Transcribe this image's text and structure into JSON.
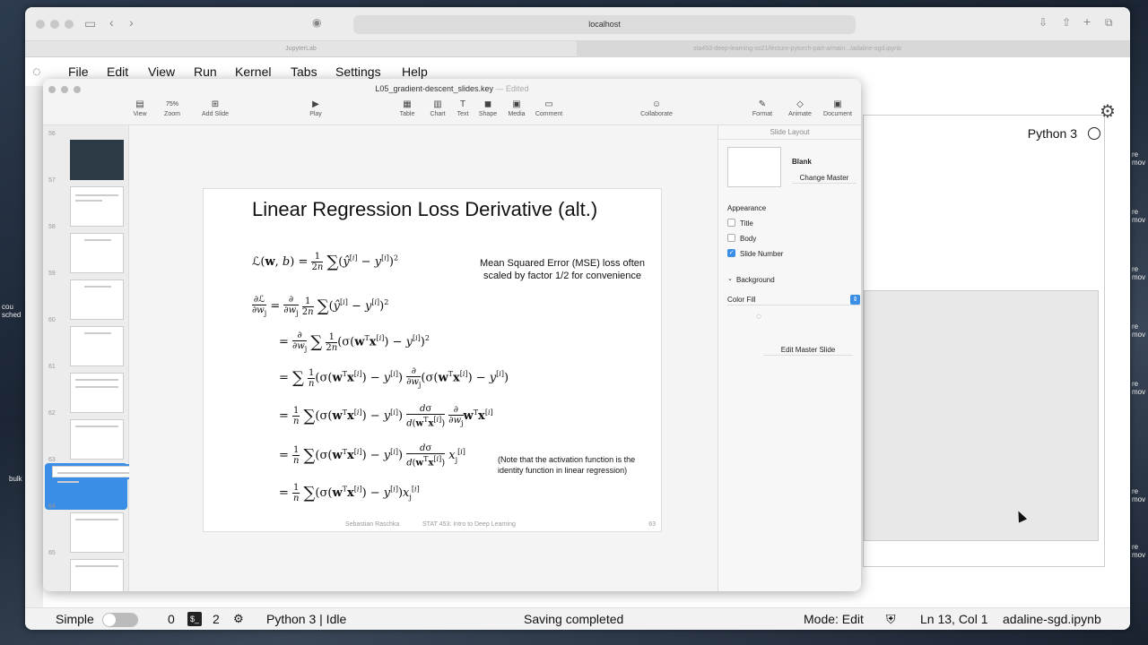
{
  "browser": {
    "url": "localhost",
    "tab1": "JupyterLab",
    "tab2": "sta453-deep-learning-ss21/lecture-pytorch-part-a/main.../adaline-sgd.ipynb"
  },
  "jupyter": {
    "menu": [
      "File",
      "Edit",
      "View",
      "Run",
      "Kernel",
      "Tabs",
      "Settings",
      "Help"
    ],
    "kernel": "Python 3",
    "status": {
      "mode_label": "Simple",
      "count_a": "0",
      "count_b": "2",
      "kernel_state": "Python 3 | Idle",
      "save_state": "Saving completed",
      "mode": "Mode: Edit",
      "cursor": "Ln 13, Col 1",
      "filename": "adaline-sgd.ipynb"
    }
  },
  "keynote": {
    "doc_title": "L05_gradient-descent_slides.key",
    "edited": "— Edited",
    "toolbar": {
      "view": "View",
      "zoom_value": "75%",
      "zoom": "Zoom",
      "add_slide": "Add Slide",
      "play": "Play",
      "table": "Table",
      "chart": "Chart",
      "text": "Text",
      "shape": "Shape",
      "media": "Media",
      "comment": "Comment",
      "collaborate": "Collaborate",
      "format": "Format",
      "animate": "Animate",
      "document": "Document"
    },
    "thumb_numbers": [
      "56",
      "57",
      "58",
      "59",
      "60",
      "61",
      "62",
      "63",
      "64",
      "65"
    ],
    "slide": {
      "title": "Linear Regression Loss Derivative (alt.)",
      "note1_line1": "Mean Squared Error (MSE) loss often",
      "note1_line2": "scaled by factor 1/2 for convenience",
      "note2_line1": "(Note that the activation function is the",
      "note2_line2": "identity function in linear regression)",
      "footer_author": "Sebastian Raschka",
      "footer_course": "STAT 453: Intro to Deep Learning",
      "page": "63"
    },
    "inspector": {
      "header": "Slide Layout",
      "blank": "Blank",
      "change_master": "Change Master",
      "appearance": "Appearance",
      "title": "Title",
      "body": "Body",
      "slide_number": "Slide Number",
      "background": "Background",
      "color_fill": "Color Fill",
      "edit_master": "Edit Master Slide"
    }
  },
  "desktop_hints": {
    "left1": "cou",
    "left2": "sched",
    "left3": "bulk",
    "right_re": "re",
    "right_mov": "mov"
  }
}
